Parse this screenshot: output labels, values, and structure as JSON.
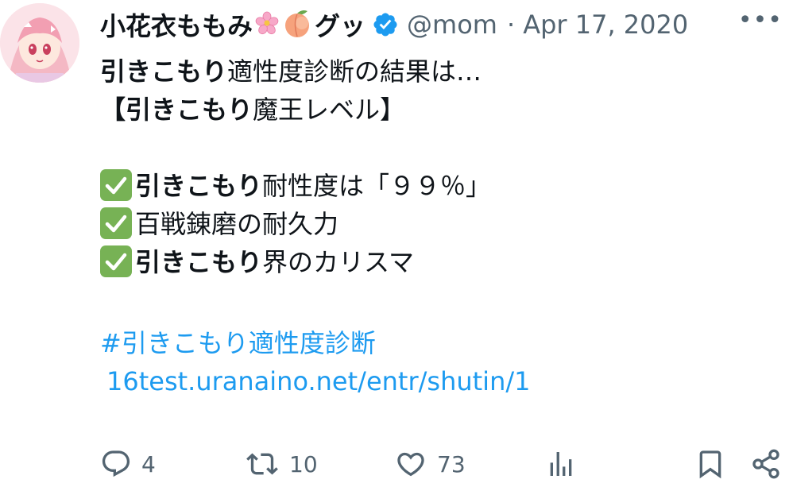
{
  "tweet": {
    "display_name": "小花衣ももみ",
    "display_name_suffix": "グッ",
    "name_emojis": [
      "cherry-blossom",
      "peach"
    ],
    "handle": "@mom",
    "separator": "·",
    "date": "Apr 17, 2020",
    "verified": true,
    "more_label": "•••",
    "body": {
      "line1_bold": "引きこもり",
      "line1_rest": "適性度診断の結果は…",
      "line2_open": "【",
      "line2_bold": "引きこもり",
      "line2_rest": "魔王レベル】",
      "check1_bold": "引きこもり",
      "check1_rest": "耐性度は「９９％」",
      "check2_text": "百戦錬磨の耐久力",
      "check3_bold": "引きこもり",
      "check3_rest": "界のカリスマ",
      "hashtag": "#引きこもり適性度診断",
      "link": "16test.uranaino.net/entr/shutin/1"
    },
    "actions": {
      "reply_count": "4",
      "retweet_count": "10",
      "like_count": "73"
    },
    "colors": {
      "link": "#1d9bf0",
      "verified": "#1d9bf0",
      "checkmark_box": "#77b255",
      "muted_text": "#536471"
    }
  }
}
